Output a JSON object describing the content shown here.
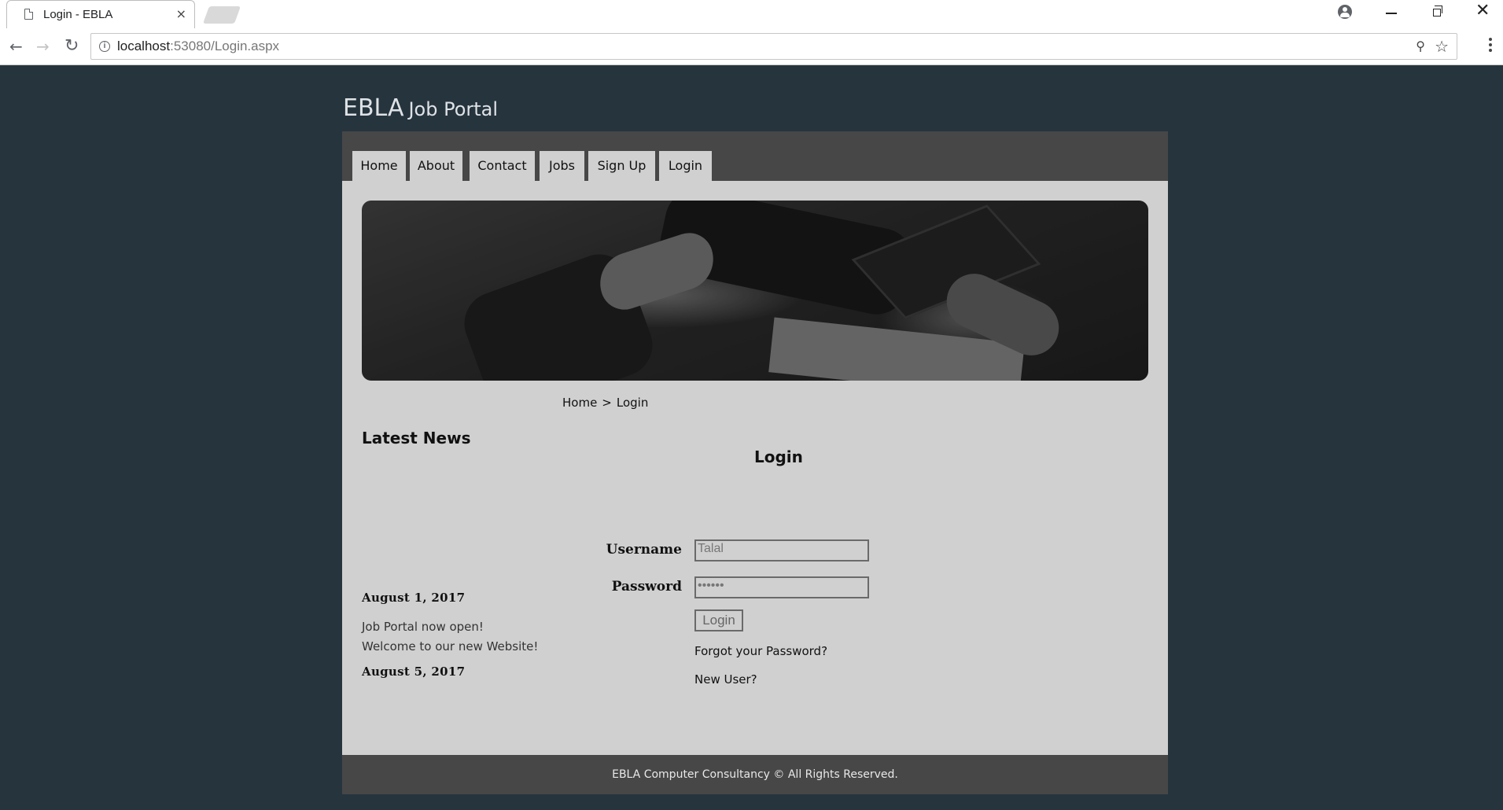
{
  "browser": {
    "tab_title": "Login - EBLA",
    "tab_close": "×",
    "url_host": "localhost",
    "url_rest": ":53080/Login.aspx",
    "close_window": "✕"
  },
  "site": {
    "brand_main": "EBLA",
    "brand_sub": "Job Portal"
  },
  "nav": {
    "items": [
      {
        "label": "Home"
      },
      {
        "label": "About"
      },
      {
        "label": "Contact"
      },
      {
        "label": "Jobs"
      },
      {
        "label": "Sign Up"
      },
      {
        "label": "Login"
      }
    ]
  },
  "breadcrumb": {
    "home": "Home",
    "separator": ">",
    "current": "Login"
  },
  "news": {
    "title": "Latest News",
    "items": [
      {
        "date": "August 1, 2017",
        "line1": "Job Portal now open!",
        "line2": "Welcome to our new Website!"
      },
      {
        "date": "August 5, 2017"
      }
    ]
  },
  "login": {
    "heading": "Login",
    "username_label": "Username",
    "username_value": "Talal",
    "password_label": "Password",
    "password_value": "••••••",
    "button_label": "Login",
    "forgot_link": "Forgot your Password?",
    "new_user_link": "New User?"
  },
  "footer": {
    "text": "EBLA Computer Consultancy © All Rights Reserved."
  }
}
